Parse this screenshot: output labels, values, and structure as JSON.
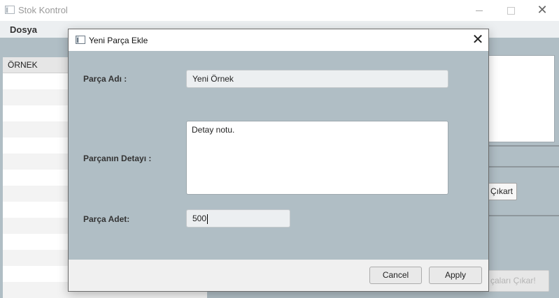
{
  "main_window": {
    "title": "Stok Kontrol",
    "menu": {
      "file": "Dosya"
    },
    "list": {
      "items": [
        "ÖRNEK"
      ]
    },
    "buttons": {
      "remove": "Çıkart",
      "remove_parts": "çaları Çıkar!"
    }
  },
  "dialog": {
    "title": "Yeni Parça Ekle",
    "fields": {
      "name_label": "Parça Adı :",
      "name_value": "Yeni Örnek",
      "detail_label": "Parçanın Detayı :",
      "detail_value": "Detay notu.",
      "qty_label": "Parça Adet:",
      "qty_value": "500"
    },
    "buttons": {
      "cancel": "Cancel",
      "apply": "Apply"
    }
  },
  "icons": [
    "app-icon",
    "close-icon",
    "minimize-icon",
    "maximize-icon"
  ],
  "colors": {
    "background": "#b0bec5",
    "footer": "#f0f0f0",
    "field": "#eceff1"
  }
}
